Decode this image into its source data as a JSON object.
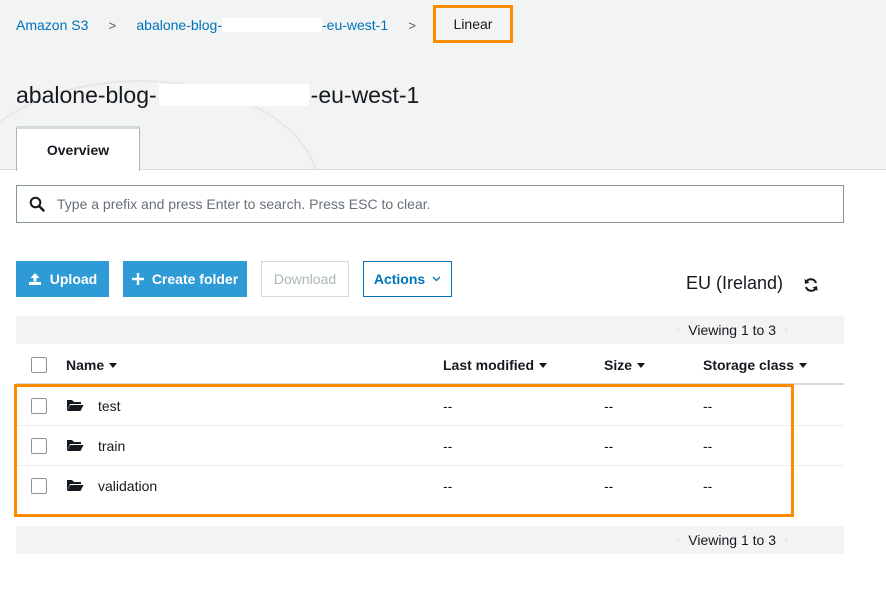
{
  "breadcrumb": {
    "root": "Amazon S3",
    "bucket_prefix": "abalone-blog-",
    "bucket_suffix": "-eu-west-1",
    "current": "Linear",
    "separator": ">"
  },
  "bucket": {
    "title_prefix": "abalone-blog-",
    "title_suffix": "-eu-west-1"
  },
  "tabs": [
    {
      "label": "Overview",
      "active": true
    }
  ],
  "search": {
    "placeholder": "Type a prefix and press Enter to search. Press ESC to clear.",
    "icon": "search-icon"
  },
  "toolbar": {
    "upload_label": "Upload",
    "create_folder_label": "Create folder",
    "download_label": "Download",
    "actions_label": "Actions"
  },
  "region": {
    "label": "EU (Ireland)"
  },
  "pager": {
    "top": "Viewing 1 to 3",
    "bottom": "Viewing 1 to 3",
    "prev": "‹",
    "next": "›"
  },
  "table": {
    "columns": [
      "Name",
      "Last modified",
      "Size",
      "Storage class"
    ],
    "rows": [
      {
        "name": "test",
        "last_modified": "--",
        "size": "--",
        "storage_class": "--"
      },
      {
        "name": "train",
        "last_modified": "--",
        "size": "--",
        "storage_class": "--"
      },
      {
        "name": "validation",
        "last_modified": "--",
        "size": "--",
        "storage_class": "--"
      }
    ]
  },
  "colors": {
    "primary": "#2e9bd6",
    "link": "#0073bb",
    "highlight": "#ff8c00",
    "band": "#f2f3f3"
  }
}
